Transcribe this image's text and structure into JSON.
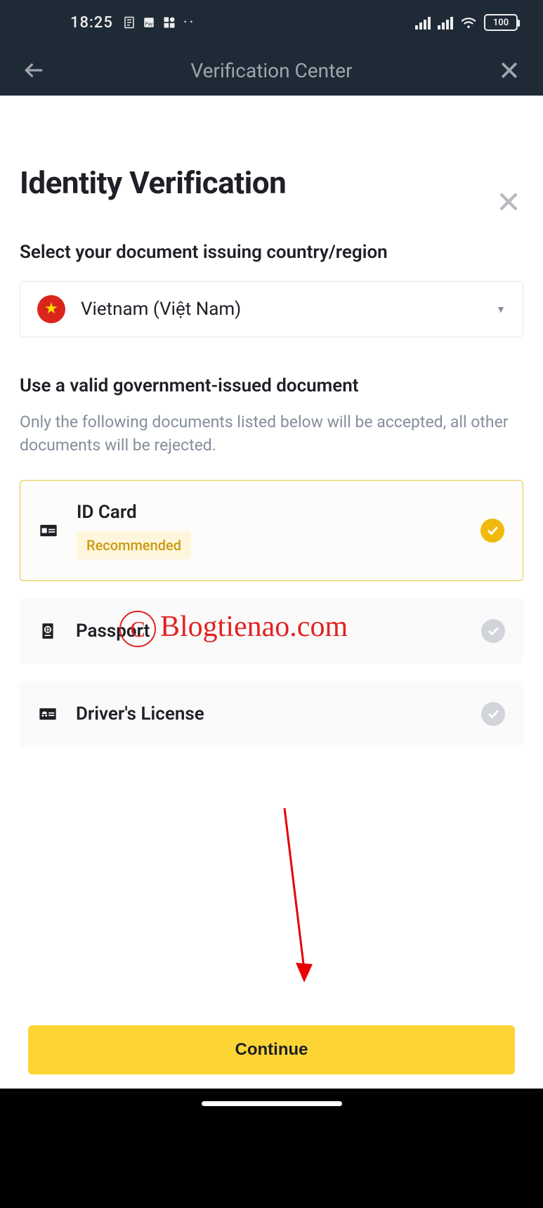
{
  "status_bar": {
    "time": "18:25",
    "battery": "100"
  },
  "header": {
    "title": "Verification Center"
  },
  "page": {
    "title": "Identity Verification",
    "select_country_label": "Select your document issuing country/region",
    "country_name": "Vietnam (Việt Nam)",
    "doc_heading": "Use a valid government-issued document",
    "doc_sub": "Only the following documents listed below will be accepted, all other documents will be rejected.",
    "options": [
      {
        "title": "ID Card",
        "badge": "Recommended",
        "selected": true
      },
      {
        "title": "Passport",
        "selected": false
      },
      {
        "title": "Driver's License",
        "selected": false
      }
    ],
    "continue_label": "Continue"
  },
  "watermark": "Blogtienao.com"
}
